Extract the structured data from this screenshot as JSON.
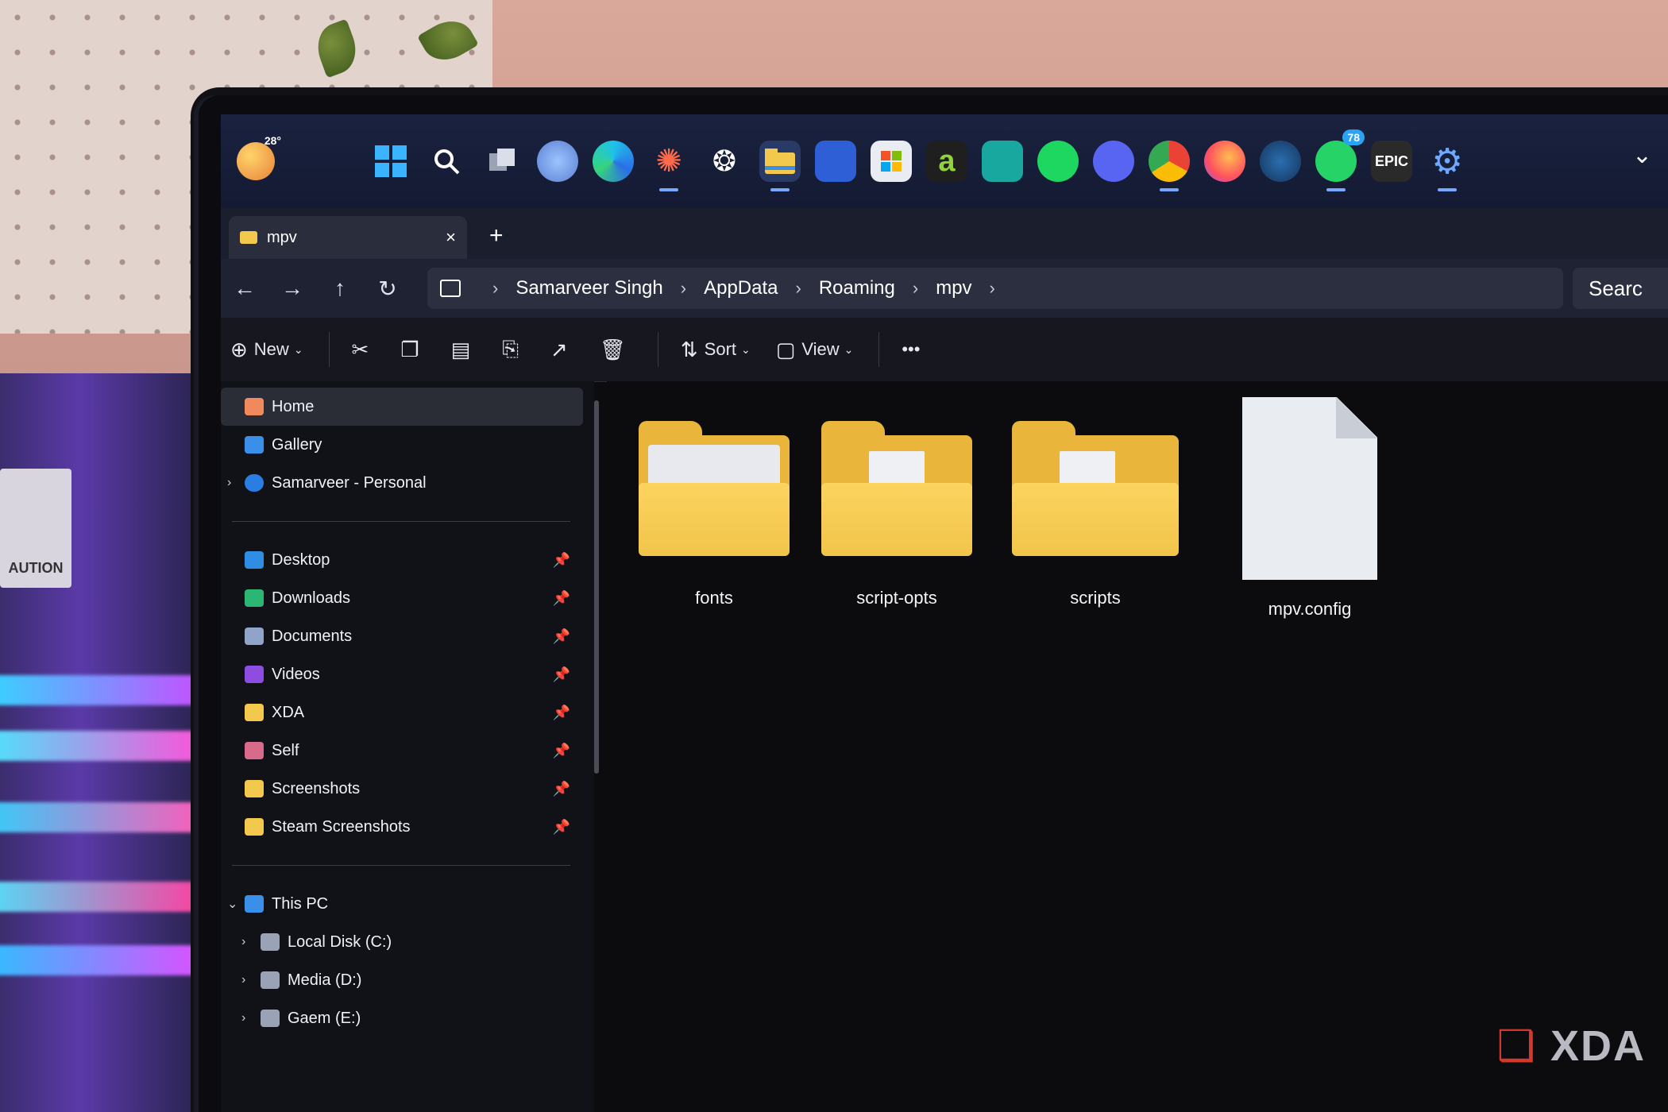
{
  "taskbar": {
    "weather_temp": "28°",
    "whatsapp_badge": "78",
    "epic_label": "EPIC"
  },
  "tab": {
    "title": "mpv",
    "close": "×",
    "add": "+"
  },
  "address": {
    "nav": [
      "←",
      "→",
      "↑",
      "↻"
    ],
    "breadcrumb": [
      "Samarveer Singh",
      "AppData",
      "Roaming",
      "mpv"
    ],
    "separator": "›",
    "search_placeholder": "Searc"
  },
  "commandbar": {
    "new_label": "New",
    "sort_label": "Sort",
    "view_label": "View",
    "more_label": "•••"
  },
  "sidebar": {
    "top": [
      {
        "label": "Home",
        "selected": true
      },
      {
        "label": "Gallery"
      },
      {
        "label": "Samarveer - Personal",
        "expander": "›"
      }
    ],
    "pinned": [
      "Desktop",
      "Downloads",
      "Documents",
      "Videos",
      "XDA",
      "Self",
      "Screenshots",
      "Steam Screenshots"
    ],
    "this_pc": {
      "label": "This PC",
      "expander": "⌄"
    },
    "drives": [
      "Local Disk (C:)",
      "Media (D:)",
      "Gaem (E:)"
    ]
  },
  "content": {
    "items": [
      {
        "name": "fonts",
        "type": "folder"
      },
      {
        "name": "script-opts",
        "type": "folder"
      },
      {
        "name": "scripts",
        "type": "folder"
      },
      {
        "name": "mpv.config",
        "type": "file"
      }
    ]
  },
  "watermark": {
    "text": "XDA",
    "mark": "❑"
  },
  "background": {
    "caution_text": "AUTION"
  }
}
